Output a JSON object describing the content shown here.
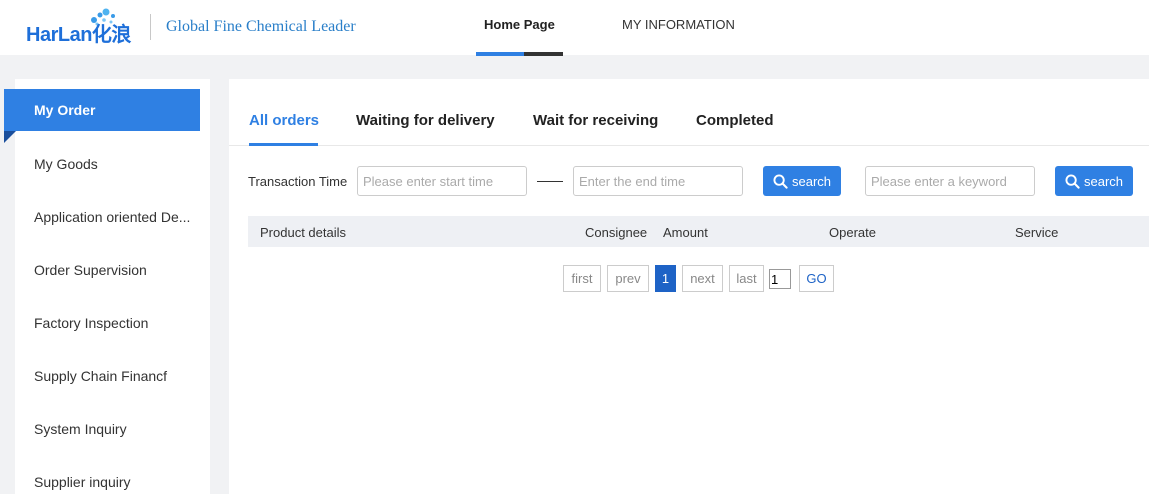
{
  "header": {
    "logo_text": "HarLan化浪",
    "slogan": "Global Fine Chemical Leader",
    "nav": [
      {
        "label": "Home Page"
      },
      {
        "label": "MY INFORMATION"
      }
    ]
  },
  "sidebar": {
    "items": [
      {
        "label": "My Order"
      },
      {
        "label": "My Goods"
      },
      {
        "label": "Application oriented De..."
      },
      {
        "label": "Order Supervision"
      },
      {
        "label": "Factory Inspection"
      },
      {
        "label": "Supply Chain Financf"
      },
      {
        "label": "System Inquiry"
      },
      {
        "label": "Supplier inquiry"
      }
    ]
  },
  "main": {
    "tabs": [
      {
        "label": "All orders"
      },
      {
        "label": "Waiting for delivery"
      },
      {
        "label": "Wait for receiving"
      },
      {
        "label": "Completed"
      }
    ],
    "filters": {
      "time_label": "Transaction Time",
      "start_placeholder": "Please enter start time",
      "end_placeholder": "Enter the end time",
      "keyword_placeholder": "Please enter a keyword",
      "search_label": "search"
    },
    "table": {
      "columns": [
        "Product details",
        "Consignee",
        "Amount",
        "Operate",
        "Service"
      ]
    },
    "pager": {
      "first": "first",
      "prev": "prev",
      "current": "1",
      "next": "next",
      "last": "last",
      "page_input": "1",
      "go": "GO"
    }
  },
  "colors": {
    "accent": "#2f80e3",
    "pager_current": "#1e63c6"
  }
}
